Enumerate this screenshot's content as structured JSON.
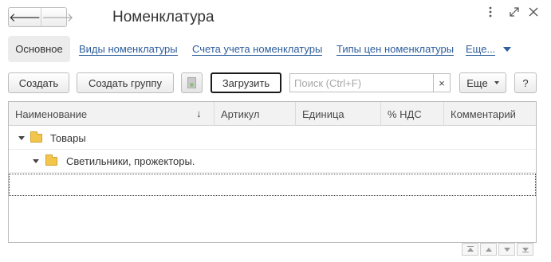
{
  "window": {
    "title": "Номенклатура",
    "menu_icon": "more-vertical-icon",
    "resize_icon": "resize-icon",
    "close_icon": "close-icon"
  },
  "nav": {
    "back_icon": "arrow-left-icon",
    "forward_icon": "arrow-right-icon"
  },
  "tabs": {
    "main": "Основное",
    "links": [
      "Виды номенклатуры",
      "Счета учета номенклатуры",
      "Типы цен номенклатуры",
      "Еще..."
    ]
  },
  "toolbar": {
    "create": "Создать",
    "create_group": "Создать группу",
    "copy_icon": "document-icon",
    "load": "Загрузить",
    "search_placeholder": "Поиск (Ctrl+F)",
    "search_clear": "×",
    "more": "Еще",
    "help": "?"
  },
  "table": {
    "columns": [
      "Наименование",
      "Артикул",
      "Единица",
      "% НДС",
      "Комментарий"
    ],
    "sort_indicator": "↓",
    "rows": [
      {
        "label": "Товары",
        "level": 0,
        "type": "folder",
        "expanded": true
      },
      {
        "label": "Светильники, прожекторы.",
        "level": 1,
        "type": "folder",
        "expanded": true
      },
      {
        "label": "",
        "level": 0,
        "type": "empty",
        "selected": true
      }
    ]
  },
  "scroll_controls": [
    "scroll-top-icon",
    "scroll-up-icon",
    "scroll-down-icon",
    "scroll-bottom-icon"
  ],
  "colors": {
    "link": "#2c5d9c",
    "folder": "#f2c64d",
    "header_bg": "#f2f2f2"
  }
}
